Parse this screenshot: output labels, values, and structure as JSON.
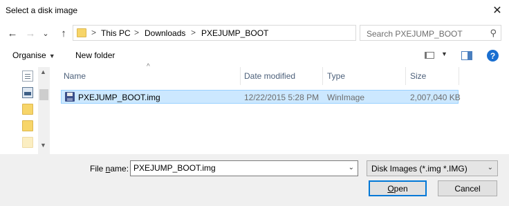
{
  "window": {
    "title": "Select a disk image",
    "close_glyph": "✕"
  },
  "nav": {
    "back_glyph": "←",
    "forward_glyph": "→",
    "recent_glyph": "⌄",
    "up_glyph": "↑",
    "breadcrumb": [
      "This PC",
      "Downloads",
      "PXEJUMP_BOOT"
    ],
    "separator": ">",
    "refresh_glyph": "↻",
    "search_placeholder": "Search PXEJUMP_BOOT",
    "search_glyph": "⚲"
  },
  "toolbar": {
    "organise_label": "Organise",
    "new_folder_label": "New folder",
    "help_glyph": "?"
  },
  "columns": {
    "name": "Name",
    "date": "Date modified",
    "type": "Type",
    "size": "Size"
  },
  "files": [
    {
      "name": "PXEJUMP_BOOT.img",
      "date": "12/22/2015 5:28 PM",
      "type": "WinImage",
      "size": "2,007,040 KB",
      "icon": "floppy-disk-icon",
      "selected": true
    }
  ],
  "footer": {
    "filename_label_prefix": "File ",
    "filename_label_accel": "n",
    "filename_label_suffix": "ame:",
    "filename_value": "PXEJUMP_BOOT.img",
    "filter_value": "Disk Images (*.img *.IMG)",
    "open_label_accel": "O",
    "open_label_rest": "pen",
    "cancel_label": "Cancel"
  },
  "colors": {
    "selection_bg": "#cce8ff",
    "selection_border": "#99d1ff",
    "accent": "#0078d7",
    "footer_bg": "#f0f0f0"
  }
}
